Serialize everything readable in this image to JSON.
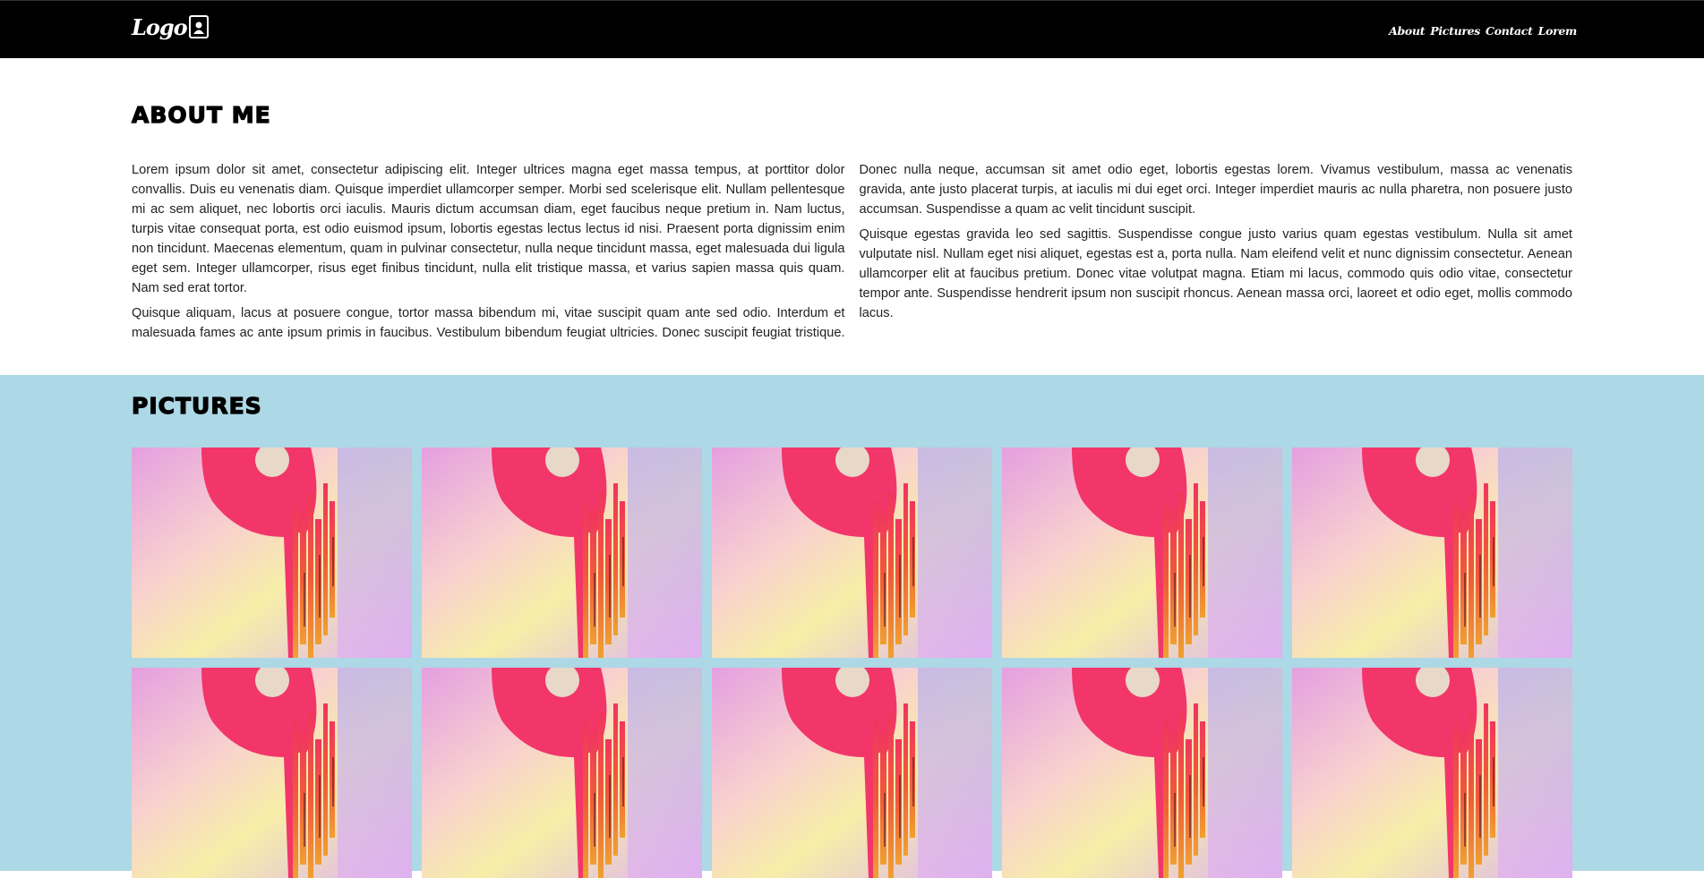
{
  "header": {
    "logo_text": "Logo",
    "logo_icon": "user-badge-icon",
    "nav": [
      "About",
      "Pictures",
      "Contact",
      "Lorem"
    ]
  },
  "about": {
    "title": "About me",
    "paragraphs": [
      "Lorem ipsum dolor sit amet, consectetur adipiscing elit. Integer ultrices magna eget massa tempus, at porttitor dolor convallis. Duis eu venenatis diam. Quisque imperdiet ullamcorper semper. Morbi sed scelerisque elit. Nullam pellentesque mi ac sem aliquet, nec lobortis orci iaculis. Mauris dictum accumsan diam, eget faucibus neque pretium in. Nam luctus, turpis vitae consequat porta, est odio euismod ipsum, lobortis egestas lectus lectus id nisi. Praesent porta dignissim enim non tincidunt. Maecenas elementum, quam in pulvinar consectetur, nulla neque tincidunt massa, eget malesuada dui ligula eget sem. Integer ullamcorper, risus eget finibus tincidunt, nulla elit tristique massa, et varius sapien massa quis quam. Nam sed erat tortor.",
      "Quisque aliquam, lacus at posuere congue, tortor massa bibendum mi, vitae suscipit quam ante sed odio. Interdum et malesuada fames ac ante ipsum primis in faucibus. Vestibulum bibendum feugiat ultricies. Donec suscipit feugiat tristique. Donec nulla neque, accumsan sit amet odio eget, lobortis egestas lorem. Vivamus vestibulum, massa ac venenatis gravida, ante justo placerat turpis, at iaculis mi dui eget orci. Integer imperdiet mauris ac nulla pharetra, non posuere justo accumsan. Suspendisse a quam ac velit tincidunt suscipit.",
      "Quisque egestas gravida leo sed sagittis. Suspendisse congue justo varius quam egestas vestibulum. Nulla sit amet vulputate nisl. Nullam eget nisi aliquet, egestas est a, porta nulla. Nam eleifend velit et nunc dignissim consectetur. Aenean ullamcorper elit at faucibus pretium. Donec vitae volutpat magna. Etiam mi lacus, commodo quis odio vitae, consectetur tempor ante. Suspendisse hendrerit ipsum non suscipit rhoncus. Aenean massa orci, laoreet et odio eget, mollis commodo lacus."
    ]
  },
  "pictures": {
    "title": "Pictures",
    "items": [
      "gallery-image",
      "gallery-image",
      "gallery-image",
      "gallery-image",
      "gallery-image",
      "gallery-image",
      "gallery-image",
      "gallery-image",
      "gallery-image",
      "gallery-image"
    ]
  },
  "colors": {
    "header_bg": "#000000",
    "pictures_bg": "#add8e6",
    "accent_red": "#f0355e"
  }
}
